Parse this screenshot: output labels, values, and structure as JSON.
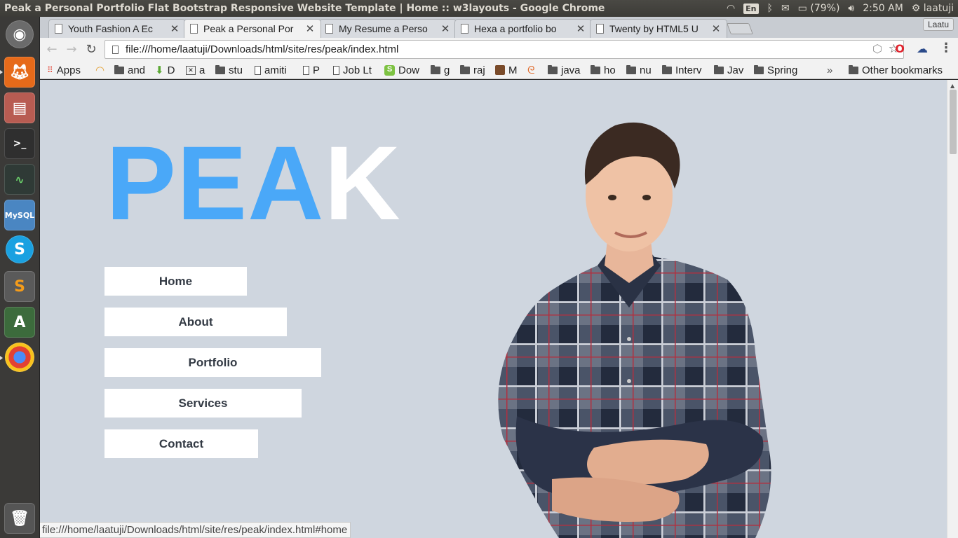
{
  "window": {
    "title": "Peak a Personal Portfolio Flat Bootstrap Responsive Website Template | Home :: w3layouts - Google Chrome"
  },
  "tray": {
    "keyboard": "En",
    "battery": "(79%)",
    "time": "2:50 AM",
    "user": "laatuji"
  },
  "browser": {
    "profile": "Laatu",
    "tabs": [
      {
        "label": "Youth Fashion A Ec",
        "active": false
      },
      {
        "label": "Peak a Personal Por",
        "active": true
      },
      {
        "label": "My Resume a Perso",
        "active": false
      },
      {
        "label": "Hexa a portfolio bo",
        "active": false
      },
      {
        "label": "Twenty by HTML5 U",
        "active": false
      }
    ],
    "url": "file:///home/laatuji/Downloads/html/site/res/peak/index.html",
    "bookmarks": [
      {
        "label": "Apps",
        "icon": "apps-grid-icon"
      },
      {
        "label": "",
        "icon": "rainbow-icon"
      },
      {
        "label": "and",
        "icon": "folder-icon"
      },
      {
        "label": "D",
        "icon": "download-icon"
      },
      {
        "label": "a",
        "icon": "image-icon"
      },
      {
        "label": "stu",
        "icon": "folder-icon"
      },
      {
        "label": "amiti",
        "icon": "page-icon"
      },
      {
        "label": "P",
        "icon": "page-icon"
      },
      {
        "label": "Job Lt",
        "icon": "page-icon"
      },
      {
        "label": "Dow",
        "icon": "s-icon"
      },
      {
        "label": "g",
        "icon": "folder-icon"
      },
      {
        "label": "raj",
        "icon": "folder-icon"
      },
      {
        "label": "M",
        "icon": "avatar-icon"
      },
      {
        "label": "",
        "icon": "swirl-icon"
      },
      {
        "label": "java",
        "icon": "folder-icon"
      },
      {
        "label": "ho",
        "icon": "folder-icon"
      },
      {
        "label": "nu",
        "icon": "folder-icon"
      },
      {
        "label": "Interv",
        "icon": "folder-icon"
      },
      {
        "label": "Jav",
        "icon": "folder-icon"
      },
      {
        "label": "Spring",
        "icon": "folder-icon"
      }
    ],
    "overflow": "»",
    "other_bookmarks": "Other bookmarks",
    "status_url": "file:///home/laatuji/Downloads/html/site/res/peak/index.html#home"
  },
  "page": {
    "logo_blue": "PEA",
    "logo_white": "K",
    "nav": [
      {
        "label": "Home"
      },
      {
        "label": "About"
      },
      {
        "label": "Portfolio"
      },
      {
        "label": "Services"
      },
      {
        "label": "Contact"
      }
    ]
  },
  "colors": {
    "page_bg": "#cfd6df",
    "logo_blue": "#4aa8f8",
    "nav_bg": "#ffffff",
    "nav_text": "#333a44"
  }
}
